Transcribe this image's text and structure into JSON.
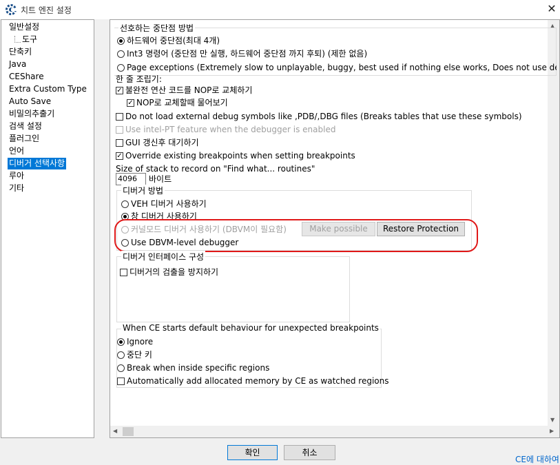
{
  "window": {
    "title": "치트 엔진 설정",
    "close_glyph": "✕",
    "icon": "cheat-engine-gear-icon"
  },
  "sidebar": {
    "items": [
      {
        "label": "일반설정"
      },
      {
        "label": "도구"
      },
      {
        "label": "단축키"
      },
      {
        "label": "Java"
      },
      {
        "label": "CEShare"
      },
      {
        "label": "Extra Custom Type"
      },
      {
        "label": "Auto Save"
      },
      {
        "label": "비밀의추출기"
      },
      {
        "label": "검색 설정"
      },
      {
        "label": "플러그인"
      },
      {
        "label": "언어"
      },
      {
        "label": "디버거 선택사항"
      },
      {
        "label": "루아"
      },
      {
        "label": "기타"
      }
    ],
    "selected": "디버거 선택사항"
  },
  "content": {
    "bp_method": {
      "title": "선호하는 중단점 방법",
      "options": [
        {
          "label": "하드웨어 중단점(최대 4개)",
          "selected": true
        },
        {
          "label": "Int3 명령어 (중단점 만 실행, 하드웨어 중단점 까지 후퇴) (제한 없음)",
          "selected": false
        },
        {
          "label": "Page exceptions (Extremely slow to unplayable, buggy, best used if nothing else works, Does not use debug",
          "selected": false
        }
      ]
    },
    "one_line": "한 줄 조립기:",
    "checks": {
      "incomplete_nop": {
        "label": "불완전 연산 코드를 NOP로 교체하기",
        "checked": true
      },
      "nop_ask": {
        "label": "NOP로 교체할때 물어보기",
        "checked": true
      },
      "no_symbols": {
        "label": "Do not load external debug symbols like ,PDB/,DBG files (Breaks tables that use these symbols)",
        "checked": false
      },
      "intel_pt": {
        "label": "Use intel-PT feature when the debugger is enabled",
        "checked": false
      },
      "gui_wait": {
        "label": "GUI 갱신후 대기하기",
        "checked": false
      },
      "override_bp": {
        "label": "Override existing breakpoints when setting breakpoints",
        "checked": true
      }
    },
    "stack": {
      "label": "Size of stack to record on \"Find what... routines\"",
      "value": "4096",
      "unit": "바이트"
    },
    "debugger_method": {
      "title": "디버거 방법",
      "options": [
        {
          "label": "VEH 디버거 사용하기",
          "selected": false
        },
        {
          "label": "창 디버거 사용하기",
          "selected": true
        },
        {
          "label": "커널모드 디버거 사용하기 (DBVM이 필요함)",
          "selected": false
        },
        {
          "label": "Use DBVM-level debugger",
          "selected": false
        }
      ],
      "make_possible": "Make possible",
      "restore_protection": "Restore Protection"
    },
    "interface": {
      "title": "디버거 인터페이스 구성",
      "hide_label": "디버거의 검출을 방지하기",
      "hide_checked": false
    },
    "unexpected": {
      "title": "When CE starts default behaviour for unexpected breakpoints",
      "options": [
        {
          "label": "Ignore",
          "selected": true
        },
        {
          "label": "중단 키",
          "selected": false
        },
        {
          "label": "Break when inside specific regions",
          "selected": false
        }
      ],
      "auto_add": {
        "label": "Automatically add allocated memory by CE as watched regions",
        "checked": false
      }
    }
  },
  "footer": {
    "ok": "확인",
    "cancel": "취소",
    "about": "CE에 대하여"
  },
  "colors": {
    "selection": "#0078d7",
    "annotation": "#e01818",
    "link": "#0066cc"
  }
}
